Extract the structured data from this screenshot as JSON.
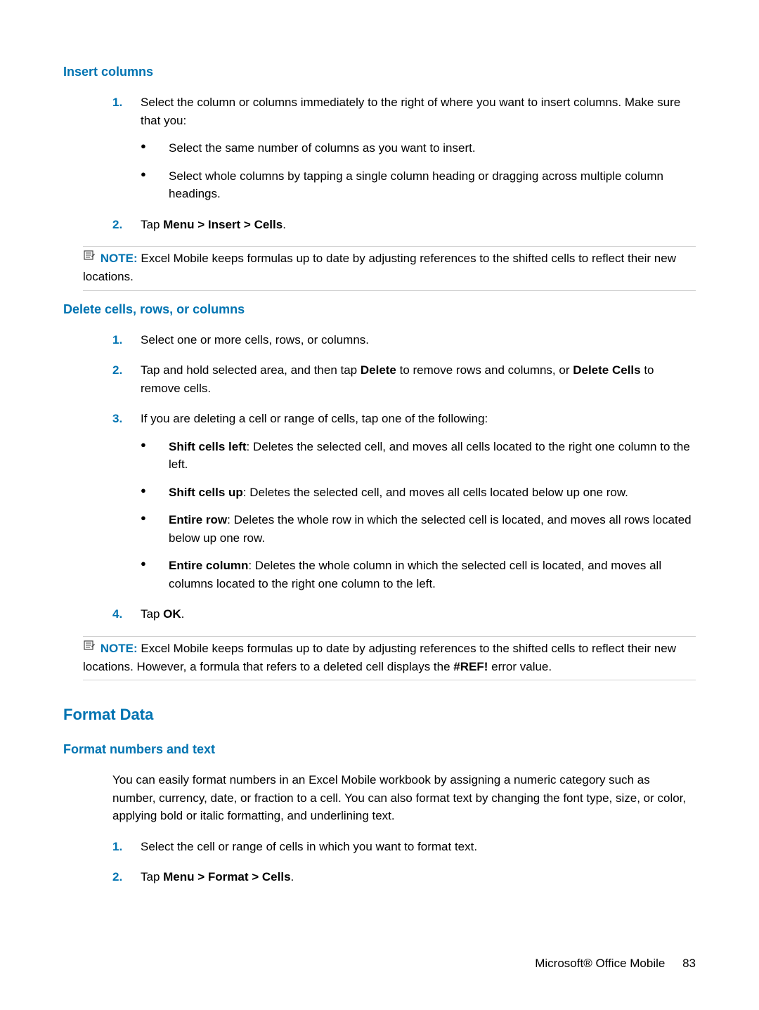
{
  "section1": {
    "title": "Insert columns",
    "step1": {
      "num": "1.",
      "text": "Select the column or columns immediately to the right of where you want to insert columns. Make sure that you:",
      "bullets": [
        "Select the same number of columns as you want to insert.",
        "Select whole columns by tapping a single column heading or dragging across multiple column headings."
      ]
    },
    "step2": {
      "num": "2.",
      "prefix": "Tap ",
      "bold": "Menu > Insert > Cells",
      "suffix": "."
    },
    "note": {
      "label": "NOTE:",
      "text": "Excel Mobile keeps formulas up to date by adjusting references to the shifted cells to reflect their new locations."
    }
  },
  "section2": {
    "title": "Delete cells, rows, or columns",
    "step1": {
      "num": "1.",
      "text": "Select one or more cells, rows, or columns."
    },
    "step2": {
      "num": "2.",
      "pre": "Tap and hold selected area, and then tap ",
      "b1": "Delete",
      "mid": " to remove rows and columns, or ",
      "b2": "Delete Cells",
      "post": " to remove cells."
    },
    "step3": {
      "num": "3.",
      "text": "If you are deleting a cell or range of cells, tap one of the following:",
      "bullets": [
        {
          "b": "Shift cells left",
          "t": ": Deletes the selected cell, and moves all cells located to the right one column to the left."
        },
        {
          "b": "Shift cells up",
          "t": ": Deletes the selected cell, and moves all cells located below up one row."
        },
        {
          "b": "Entire row",
          "t": ": Deletes the whole row in which the selected cell is located, and moves all rows located below up one row."
        },
        {
          "b": "Entire column",
          "t": ": Deletes the whole column in which the selected cell is located, and moves all columns located to the right one column to the left."
        }
      ]
    },
    "step4": {
      "num": "4.",
      "prefix": "Tap ",
      "bold": "OK",
      "suffix": "."
    },
    "note": {
      "label": "NOTE:",
      "pre": "Excel Mobile keeps formulas up to date by adjusting references to the shifted cells to reflect their new locations. However, a formula that refers to a deleted cell displays the ",
      "bold": "#REF!",
      "post": " error value."
    }
  },
  "section3": {
    "mainTitle": "Format Data",
    "title": "Format numbers and text",
    "intro": "You can easily format numbers in an Excel Mobile workbook by assigning a numeric category such as number, currency, date, or fraction to a cell. You can also format text by changing the font type, size, or color, applying bold or italic formatting, and underlining text.",
    "step1": {
      "num": "1.",
      "text": "Select the cell or range of cells in which you want to format text."
    },
    "step2": {
      "num": "2.",
      "prefix": "Tap ",
      "bold": "Menu > Format > Cells",
      "suffix": "."
    }
  },
  "footer": {
    "text": "Microsoft® Office Mobile",
    "page": "83"
  }
}
